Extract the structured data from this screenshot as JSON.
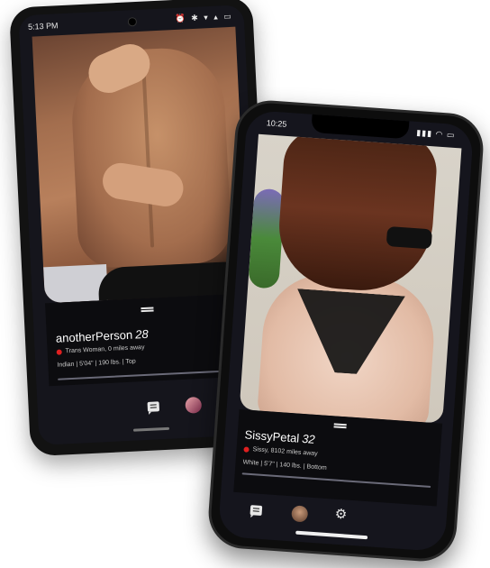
{
  "phone_back": {
    "status": {
      "time": "5:13 PM",
      "icons": "⏰ ✱ ▾ ▴ ▭"
    },
    "profile": {
      "name": "anotherPerson",
      "age": "28",
      "line1": "Trans Woman, 0 miles away",
      "line2": "Indian | 5'04\" | 190 lbs. | Top"
    },
    "nav": {
      "messages_icon": "chat-icon",
      "profile_icon": "avatar",
      "settings_icon": "gear-icon"
    },
    "status_color": "#e02020"
  },
  "phone_front": {
    "status": {
      "time": "10:25",
      "icons": "▮▮▮ ◠ ▭"
    },
    "profile": {
      "name": "SissyPetal",
      "age": "32",
      "line1": "Sissy, 8102 miles away",
      "line2": "White | 5'7\" | 140 lbs. | Bottom"
    },
    "nav": {
      "messages_icon": "chat-icon",
      "profile_icon": "avatar",
      "settings_icon": "gear-icon"
    },
    "status_color": "#e02020"
  }
}
